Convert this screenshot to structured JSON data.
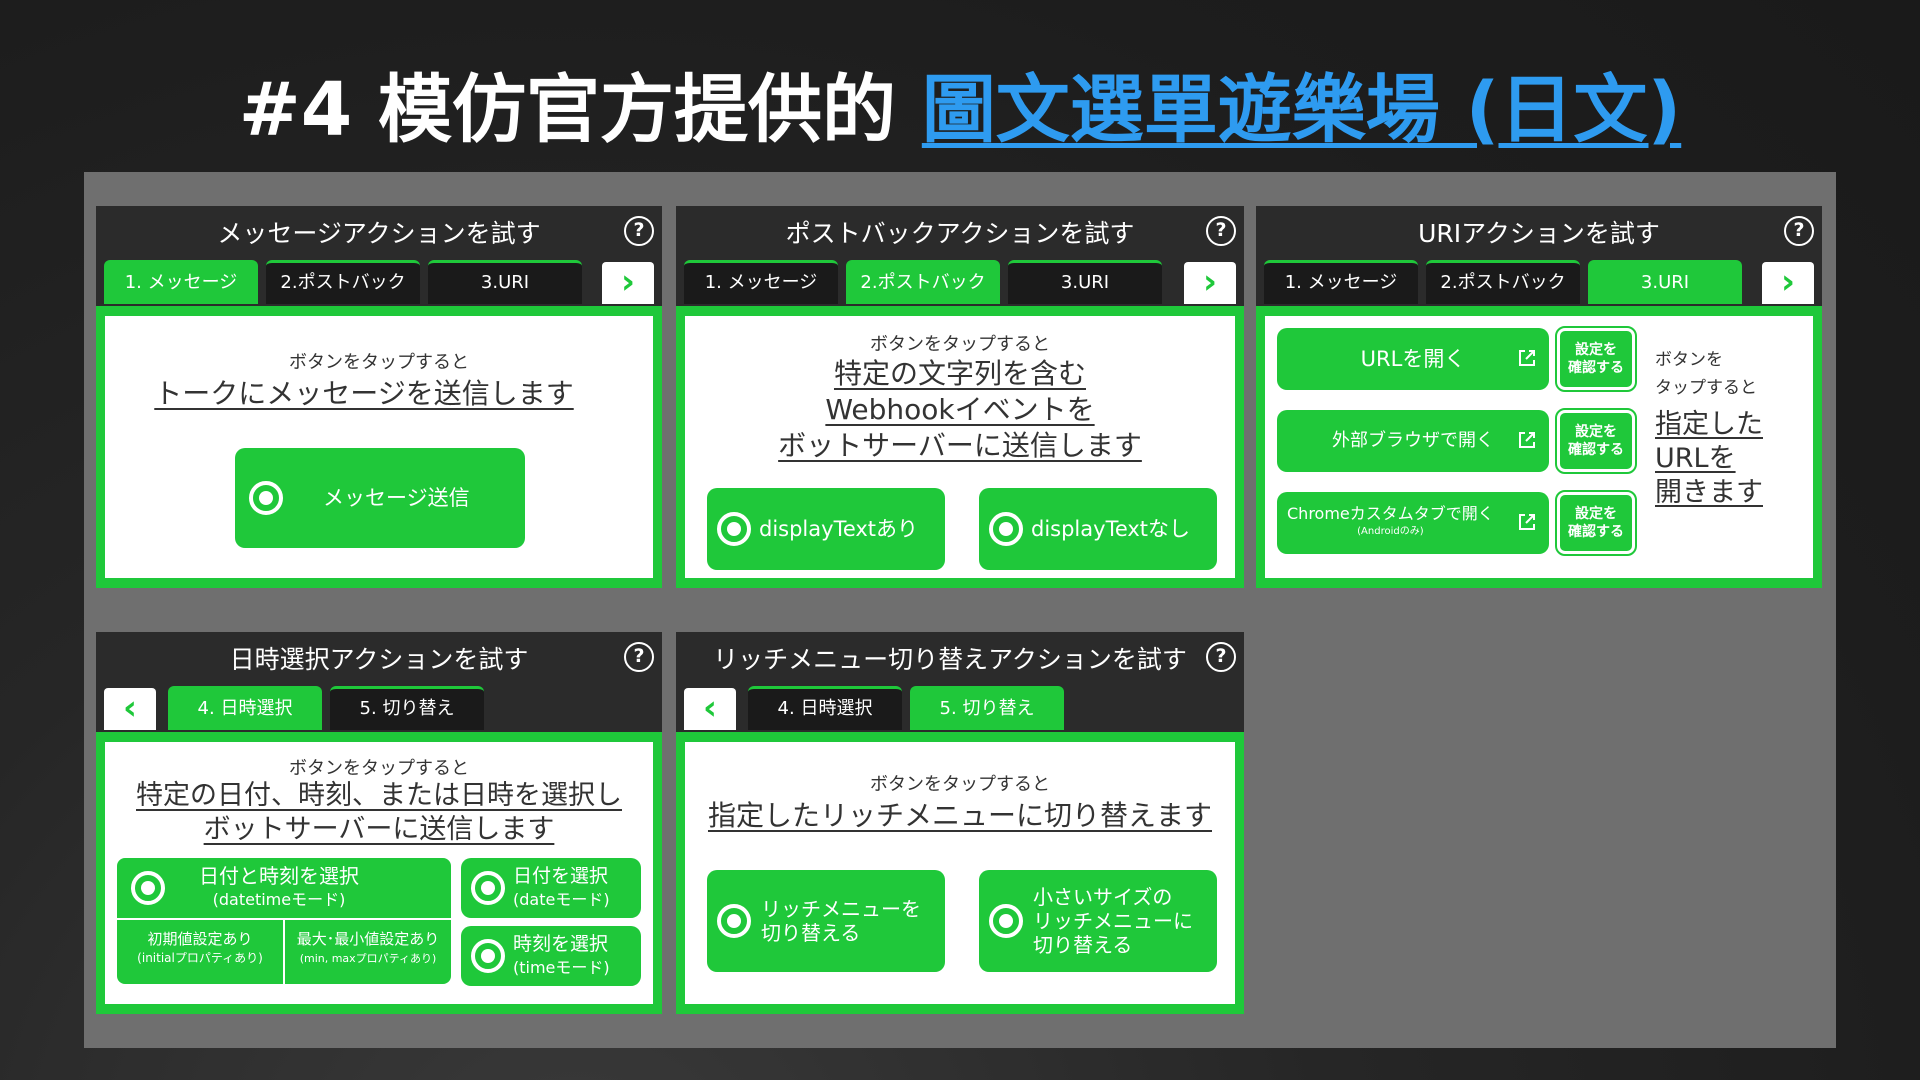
{
  "page": {
    "title_prefix": "#4 模仿官方提供的",
    "title_link": "圖文選單遊樂場 (日文)"
  },
  "colors": {
    "accent": "#1fc83a",
    "dark": "#2b2b2b",
    "link": "#2e9bf0"
  },
  "tabs": {
    "message": "1. メッセージ",
    "postback": "2.ポストバック",
    "uri": "3.URI",
    "datetime": "4. 日時選択",
    "switch": "5. 切り替え"
  },
  "common": {
    "help": "?",
    "next": "›",
    "prev": "‹",
    "tap_lead": "ボタンをタップすると"
  },
  "panel_message": {
    "title": "メッセージアクションを試す",
    "headline": "トークにメッセージを送信します",
    "button": "メッセージ送信"
  },
  "panel_postback": {
    "title": "ポストバックアクションを試す",
    "headline_1": "特定の文字列を含む",
    "headline_2": "Webhookイベントを",
    "headline_3": "ボットサーバーに送信します",
    "button_with": "displayTextあり",
    "button_without": "displayTextなし"
  },
  "panel_uri": {
    "title": "URIアクションを試す",
    "open_url": "URLを開く",
    "external_browser": "外部ブラウザで開く",
    "chrome_tab": "Chromeカスタムタブで開く",
    "chrome_sub": "(Androidのみ)",
    "confirm_1": "設定を",
    "confirm_2": "確認する",
    "note_1": "ボタンを",
    "note_2": "タップすると",
    "big_1": "指定した",
    "big_2": "URLを",
    "big_3": "開きます"
  },
  "panel_datetime": {
    "title": "日時選択アクションを試す",
    "headline_1": "特定の日付、時刻、または日時を選択し",
    "headline_2": "ボットサーバーに送信します",
    "datetime_btn": "日付と時刻を選択",
    "datetime_sub": "(datetimeモード)",
    "initial_btn": "初期値設定あり",
    "initial_sub": "(initialプロパティあり)",
    "minmax_btn": "最大･最小値設定あり",
    "minmax_sub": "(min, maxプロパティあり)",
    "date_btn": "日付を選択",
    "date_sub": "(dateモード)",
    "time_btn": "時刻を選択",
    "time_sub": "(timeモード)"
  },
  "panel_switch": {
    "title": "リッチメニュー切り替えアクションを試す",
    "headline": "指定したリッチメニューに切り替えます",
    "btn1_1": "リッチメニューを",
    "btn1_2": "切り替える",
    "btn2_1": "小さいサイズの",
    "btn2_2": "リッチメニューに",
    "btn2_3": "切り替える"
  }
}
